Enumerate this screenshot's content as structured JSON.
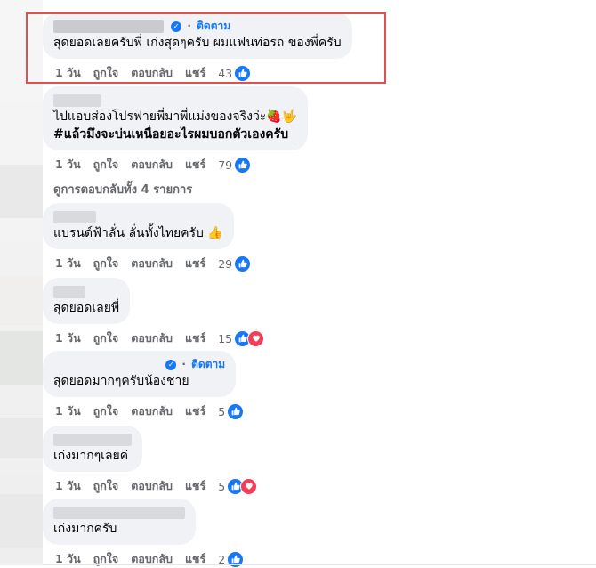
{
  "labels": {
    "follow": "ติดตาม",
    "dot": "·",
    "like": "ถูกใจ",
    "reply": "ตอบกลับ",
    "share": "แชร์",
    "view_replies": "ดูการตอบกลับทั้ง 4 รายการ"
  },
  "comments": [
    {
      "text": "สุดยอดเลยครับพี่ เก่งสุดๆครับ ผมแฟนท่อรถ ของพี่ครับ",
      "time": "1 วัน",
      "count": "43",
      "reactions": [
        "like"
      ],
      "verified": true
    },
    {
      "text": "ไปแอบส่องโปรฟายพี่มาพี่แม่งของจริงว่ะ",
      "emoji": "🍓🤟",
      "text2": "#แล้วมึงจะบ่นเหนื่อยอะไรผมบอกตัวเองครับ",
      "time": "1 วัน",
      "count": "79",
      "reactions": [
        "like"
      ]
    },
    {
      "text": "แบรนด์ฟ้าลั่น ลั่นทั้งไทยครับ",
      "emoji": "👍",
      "time": "1 วัน",
      "count": "29",
      "reactions": [
        "like"
      ]
    },
    {
      "text": "สุดยอดเลยพี่",
      "time": "1 วัน",
      "count": "15",
      "reactions": [
        "like",
        "heart"
      ]
    },
    {
      "text": "สุดยอดมากๆครับน้องชาย",
      "time": "1 วัน",
      "count": "5",
      "reactions": [
        "like"
      ],
      "verified": true
    },
    {
      "text": "เก่งมากๆเลยค่",
      "time": "1 วัน",
      "count": "5",
      "reactions": [
        "like",
        "heart"
      ]
    },
    {
      "text": "เก่งมากครับ",
      "time": "1 วัน",
      "count": "2",
      "reactions": [
        "like"
      ]
    }
  ],
  "colors": {
    "accent": "#1877f2",
    "heart": "#f33e58",
    "bubble": "#f0f2f5",
    "highlight": "#e05050",
    "meta": "#65676b"
  },
  "icons": {
    "verified": "verified-badge-icon",
    "like": "like-icon",
    "heart": "heart-icon"
  }
}
